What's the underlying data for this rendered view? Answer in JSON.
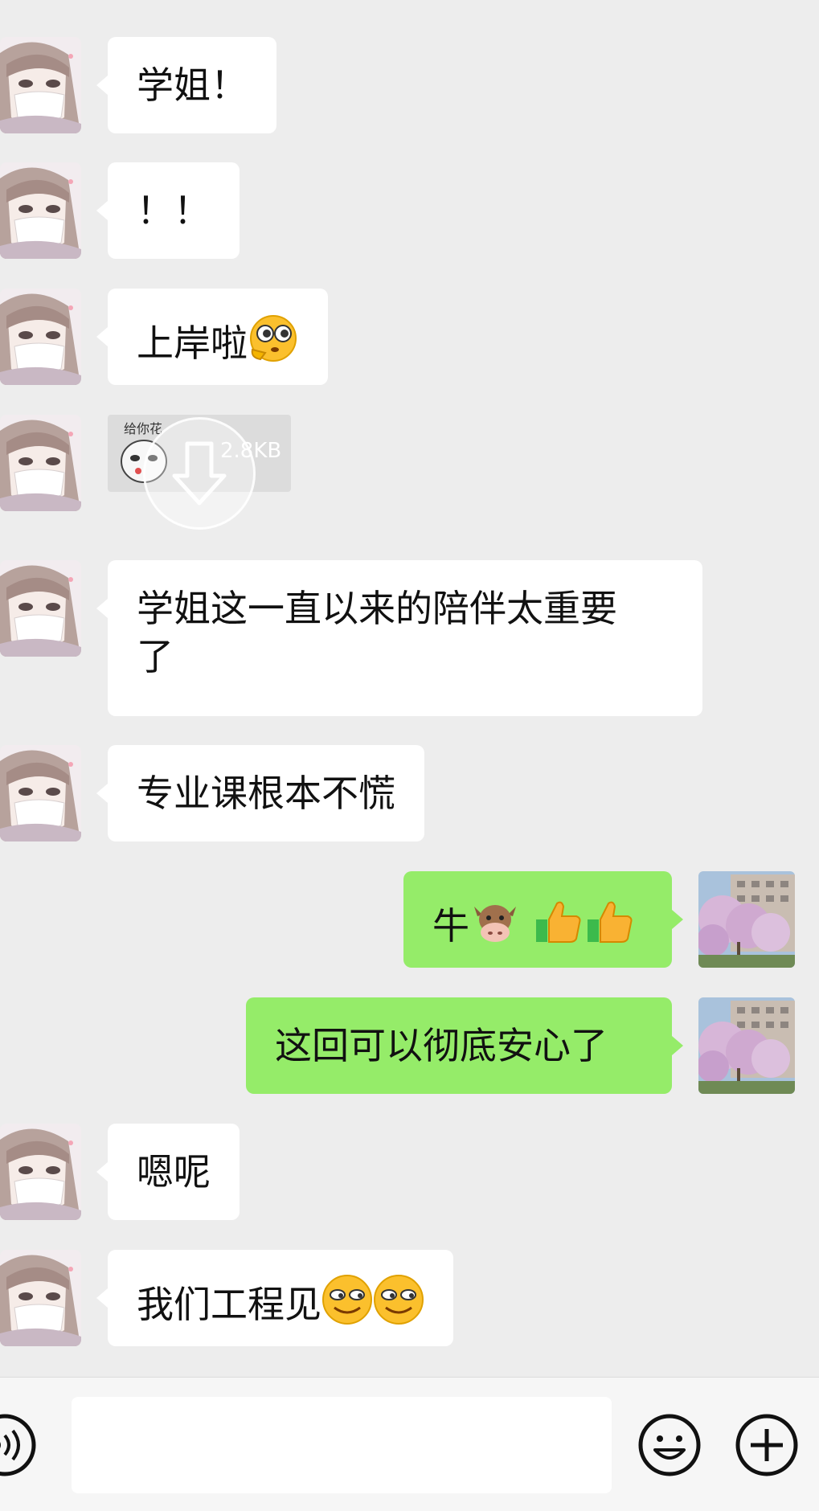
{
  "messages": [
    {
      "side": "received",
      "text": "学姐！"
    },
    {
      "side": "received",
      "text": "！！"
    },
    {
      "side": "received",
      "text": "上岸啦",
      "emoji": "pleading-face-emoji"
    },
    {
      "side": "received",
      "type": "sticker",
      "caption": "给你花",
      "size": "2.8KB",
      "icon": "download-arrow-icon"
    },
    {
      "side": "received",
      "text_line1": "学姐这一直以来的陪伴太重要",
      "text_line2": "了"
    },
    {
      "side": "received",
      "text": "专业课根本不慌"
    },
    {
      "side": "sent",
      "text": "牛",
      "emojis": [
        "cow-face-emoji",
        "thumbs-up-emoji",
        "thumbs-up-emoji"
      ]
    },
    {
      "side": "sent",
      "text": "这回可以彻底安心了"
    },
    {
      "side": "received",
      "text": "嗯呢"
    },
    {
      "side": "received",
      "text": "我们工程见",
      "emojis": [
        "smirk-emoji",
        "smirk-emoji"
      ]
    }
  ],
  "input_bar": {
    "placeholder": "",
    "icons": [
      "voice-icon",
      "emoji-icon",
      "plus-icon"
    ]
  },
  "colors": {
    "background": "#ededed",
    "received_bubble": "#ffffff",
    "sent_bubble": "#95ec69"
  }
}
